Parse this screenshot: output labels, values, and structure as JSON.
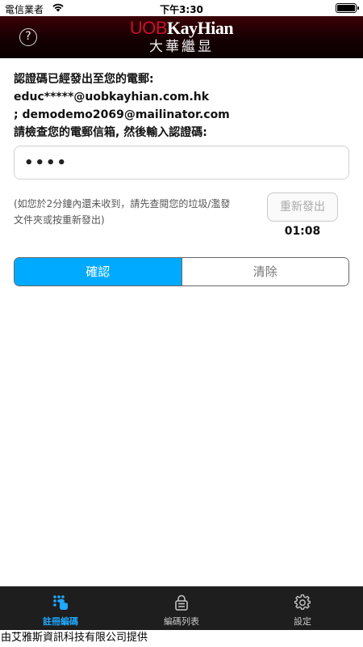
{
  "status_bar": {
    "carrier": "電信業者",
    "time": "下午3:30",
    "battery_level": 1.0
  },
  "header": {
    "help_glyph": "?",
    "logo_uob": "UOB",
    "logo_kayhian": "KayHian",
    "logo_chinese": "大華繼显"
  },
  "main": {
    "message_line1": "認證碼已經發出至您的電郵: educ*****@uobkayhian.com.hk",
    "message_line2": "; demodemo2069@mailinator.com",
    "message_line3": "請檢查您的電郵信箱, 然後輸入認證碼:",
    "code_value": "••••",
    "hint_text": "(如您於2分鐘內還未收到，請先查閱您的垃圾/濫發文件夾或按重新發出)",
    "resend_label": "重新發出",
    "countdown": "01:08",
    "confirm_label": "確認",
    "clear_label": "清除"
  },
  "tabbar": {
    "items": [
      {
        "label": "註冊編碼",
        "icon": "dots-hand-icon",
        "active": true
      },
      {
        "label": "編碼列表",
        "icon": "lock-list-icon",
        "active": false
      },
      {
        "label": "設定",
        "icon": "gear-icon",
        "active": false
      }
    ]
  },
  "footer": {
    "text": "由艾雅斯資訊科技有限公司提供"
  },
  "colors": {
    "accent": "#00aaff",
    "header_bg": "#1a0003",
    "brand_red": "#c8102e",
    "tabbar_bg": "#1e1e1e",
    "active_tab": "#1fa9ff"
  }
}
